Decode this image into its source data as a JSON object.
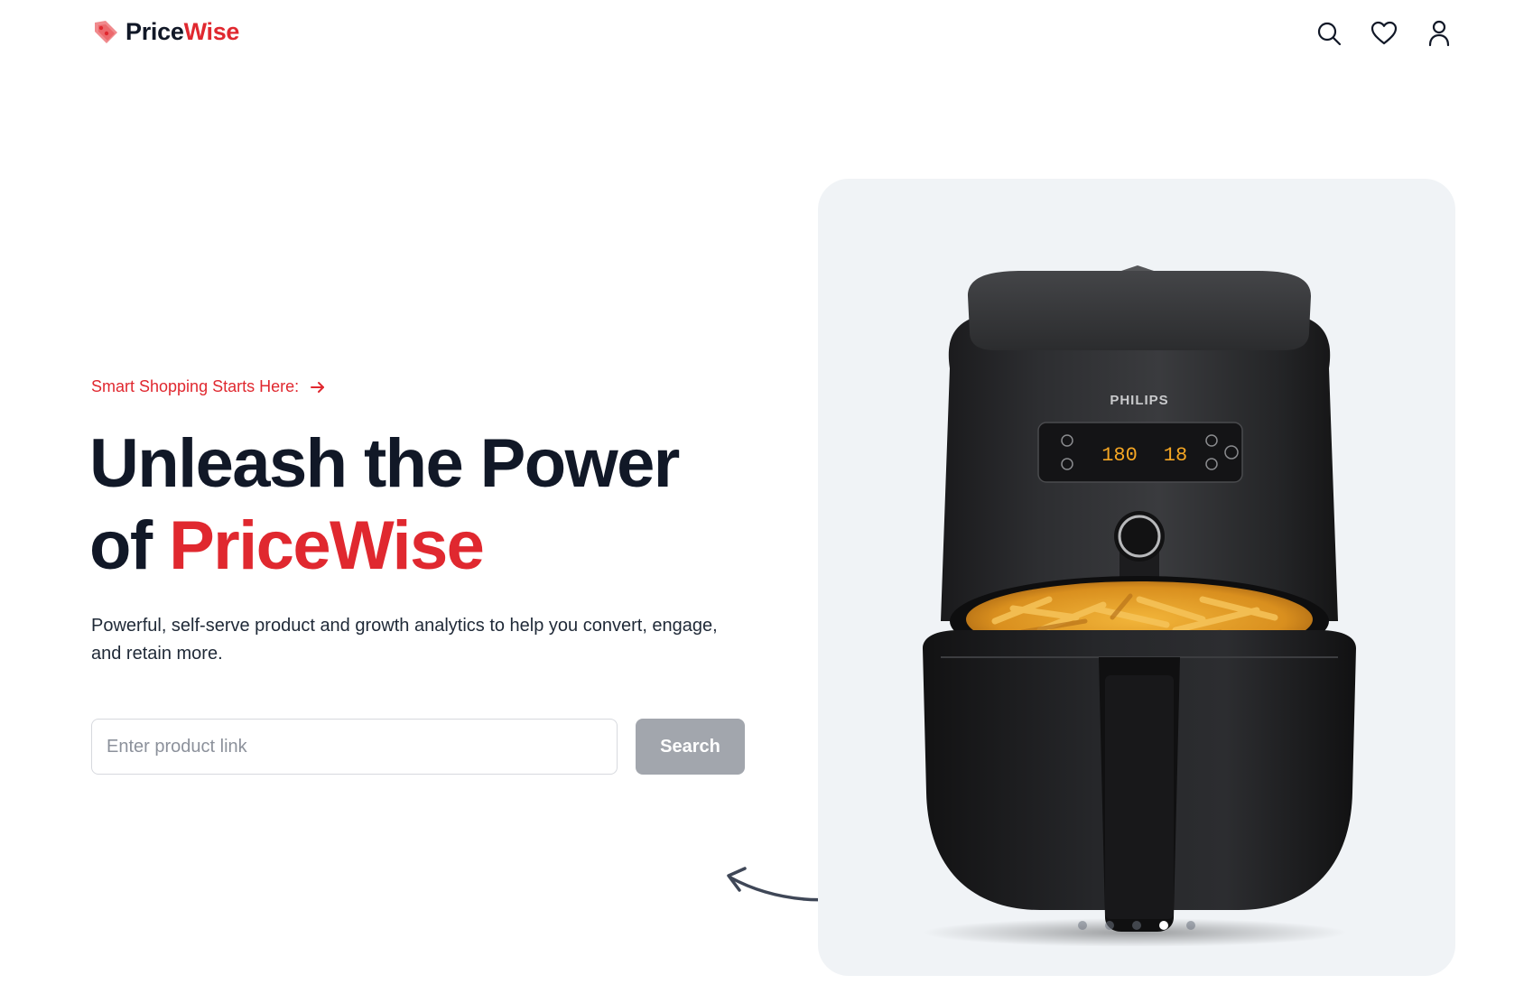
{
  "brand": {
    "name_part1": "Price",
    "name_part2": "Wise",
    "accent_color": "#e0282f",
    "text_color": "#111827"
  },
  "nav": {
    "icons": [
      "search-icon",
      "heart-icon",
      "user-icon"
    ]
  },
  "hero": {
    "tagline": "Smart Shopping Starts Here:",
    "headline_line1": "Unleash the Power",
    "headline_of": "of",
    "headline_brand": "PriceWise",
    "subtext": "Powerful, self-serve product and growth analytics to help you convert, engage, and retain more.",
    "input_placeholder": "Enter product link",
    "input_value": "",
    "search_label": "Search"
  },
  "product_image": {
    "brand_label": "PHILIPS",
    "display_temp": "180",
    "display_time": "18",
    "carousel_slides": 5,
    "carousel_active": 4
  }
}
